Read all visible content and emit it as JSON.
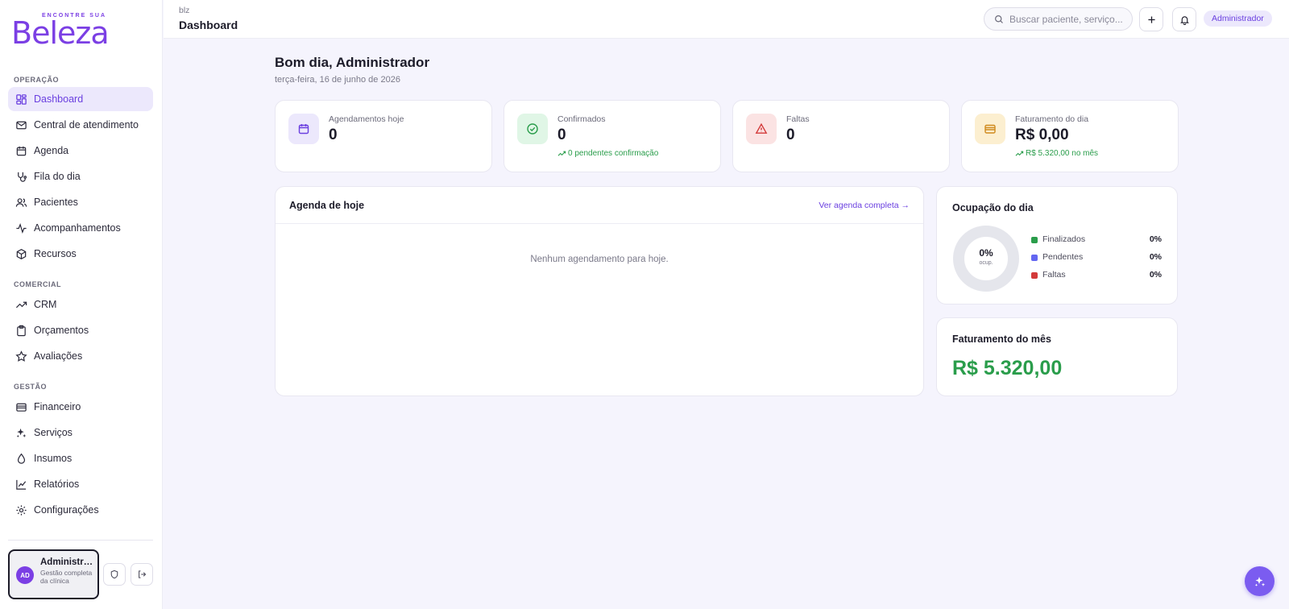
{
  "brand": {
    "tagline": "ENCONTRE SUA",
    "name": "Beleza"
  },
  "sidebar": {
    "sections": [
      {
        "title": "OPERAÇÃO",
        "items": [
          {
            "label": "Dashboard",
            "icon": "dashboard-icon",
            "active": true
          },
          {
            "label": "Central de atendimento",
            "icon": "mail-icon"
          },
          {
            "label": "Agenda",
            "icon": "calendar-icon"
          },
          {
            "label": "Fila do dia",
            "icon": "stethoscope-icon"
          },
          {
            "label": "Pacientes",
            "icon": "users-icon"
          },
          {
            "label": "Acompanhamentos",
            "icon": "activity-icon"
          },
          {
            "label": "Recursos",
            "icon": "box-icon"
          }
        ]
      },
      {
        "title": "COMERCIAL",
        "items": [
          {
            "label": "CRM",
            "icon": "trending-up-icon"
          },
          {
            "label": "Orçamentos",
            "icon": "clipboard-icon"
          },
          {
            "label": "Avaliações",
            "icon": "star-icon"
          }
        ]
      },
      {
        "title": "GESTÃO",
        "items": [
          {
            "label": "Financeiro",
            "icon": "wallet-icon"
          },
          {
            "label": "Serviços",
            "icon": "sparkles-icon"
          },
          {
            "label": "Insumos",
            "icon": "droplet-icon"
          },
          {
            "label": "Relatórios",
            "icon": "line-chart-icon"
          },
          {
            "label": "Configurações",
            "icon": "gear-icon"
          }
        ]
      }
    ],
    "user": {
      "initials": "AD",
      "name": "Administrador",
      "role": "Gestão completa da clínica"
    }
  },
  "header": {
    "breadcrumb": "blz",
    "title": "Dashboard",
    "search_placeholder": "Buscar paciente, serviço...",
    "role_badge": "Administrador"
  },
  "main": {
    "greeting": "Bom dia, Administrador",
    "date": "terça-feira, 16 de junho de 2026",
    "stats": [
      {
        "label": "Agendamentos hoje",
        "value": "0",
        "sub": "",
        "icon": "calendar-icon",
        "icon_bg": "#ece8fc",
        "icon_color": "#6a3fe0"
      },
      {
        "label": "Confirmados",
        "value": "0",
        "sub": "0 pendentes confirmação",
        "icon": "check-circle-icon",
        "icon_bg": "#e0f6e6",
        "icon_color": "#2a9d4b"
      },
      {
        "label": "Faltas",
        "value": "0",
        "sub": "",
        "icon": "alert-triangle-icon",
        "icon_bg": "#fbe3e3",
        "icon_color": "#d33a3a"
      },
      {
        "label": "Faturamento do dia",
        "value": "R$ 0,00",
        "sub": "R$ 5.320,00 no mês",
        "icon": "wallet-icon",
        "icon_bg": "#fcefd0",
        "icon_color": "#d08a1d"
      }
    ],
    "agenda": {
      "title": "Agenda de hoje",
      "link": "Ver agenda completa →",
      "empty": "Nenhum agendamento para hoje."
    },
    "occupancy": {
      "title": "Ocupação do dia",
      "percent": "0%",
      "percent_sub": "ocup.",
      "legend": [
        {
          "label": "Finalizados",
          "value": "0%",
          "color": "#2a9d4b"
        },
        {
          "label": "Pendentes",
          "value": "0%",
          "color": "#6366f1"
        },
        {
          "label": "Faltas",
          "value": "0%",
          "color": "#d33a3a"
        }
      ]
    },
    "month_revenue": {
      "title": "Faturamento do mês",
      "value": "R$ 5.320,00"
    }
  },
  "colors": {
    "accent": "#6a3fe0",
    "success": "#2a9d4b",
    "danger": "#d33a3a",
    "background": "#f5f4fd"
  }
}
